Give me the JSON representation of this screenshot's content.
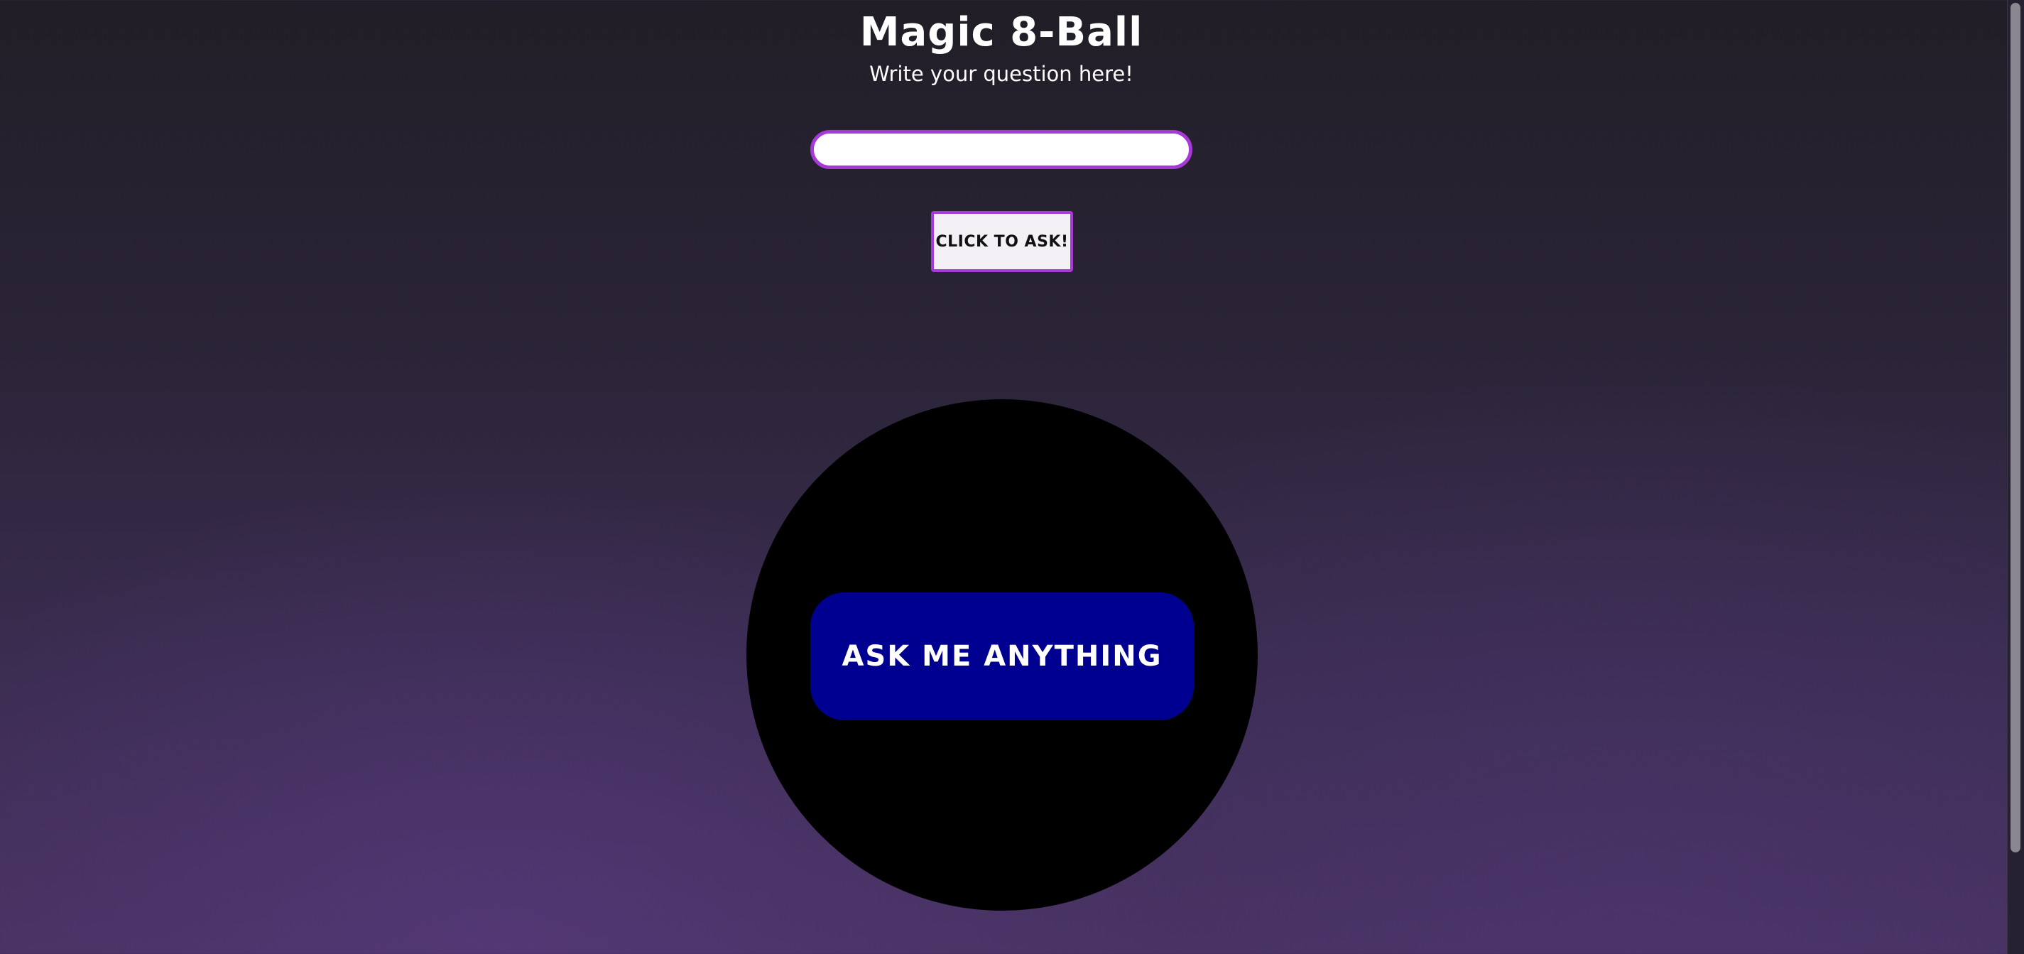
{
  "page": {
    "title": "Magic 8-Ball",
    "subtitle": "Write your question here!"
  },
  "question_input": {
    "value": "",
    "placeholder": ""
  },
  "ask_button": {
    "label": "Click to ask!"
  },
  "eight_ball": {
    "answer_text": "Ask me anything"
  },
  "colors": {
    "accent_border": "#a53ad6",
    "ball": "#000000",
    "answer_window": "#000090",
    "background_top": "#211e27",
    "background_bottom": "#47325f"
  }
}
